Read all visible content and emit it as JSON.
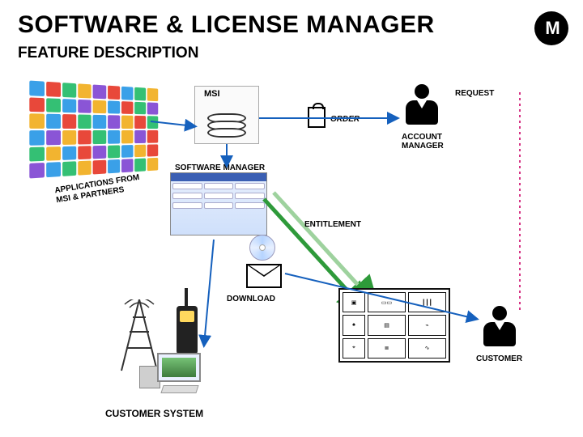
{
  "header": {
    "title": "SOFTWARE & LICENSE MANAGER",
    "subtitle": "FEATURE DESCRIPTION",
    "logo_text": "M"
  },
  "labels": {
    "msi": "MSI",
    "request": "REQUEST",
    "order": "ORDER",
    "account_manager": "ACCOUNT\nMANAGER",
    "applications_from": "APPLICATIONS FROM\nMSI & PARTNERS",
    "software_manager": "SOFTWARE MANAGER",
    "entitlement": "ENTITLEMENT",
    "download": "DOWNLOAD",
    "customer": "CUSTOMER",
    "customer_system": "CUSTOMER SYSTEM"
  },
  "tile_colors": [
    "#3aa0e8",
    "#e8483a",
    "#34c074",
    "#f2b430",
    "#8a55d6",
    "#e8483a",
    "#3aa0e8",
    "#34c074",
    "#f2b430",
    "#e8483a",
    "#34c074",
    "#3aa0e8",
    "#8a55d6",
    "#f2b430",
    "#3aa0e8",
    "#e8483a",
    "#34c074",
    "#8a55d6",
    "#f2b430",
    "#3aa0e8",
    "#e8483a",
    "#34c074",
    "#3aa0e8",
    "#8a55d6",
    "#f2b430",
    "#e8483a",
    "#34c074",
    "#3aa0e8",
    "#8a55d6",
    "#f2b430",
    "#e8483a",
    "#34c074",
    "#3aa0e8",
    "#f2b430",
    "#8a55d6",
    "#e8483a",
    "#34c074",
    "#f2b430",
    "#3aa0e8",
    "#e8483a",
    "#8a55d6",
    "#34c074",
    "#3aa0e8",
    "#f2b430",
    "#e8483a",
    "#8a55d6",
    "#3aa0e8",
    "#34c074",
    "#f2b430",
    "#e8483a",
    "#3aa0e8",
    "#8a55d6",
    "#34c074",
    "#f2b430"
  ]
}
